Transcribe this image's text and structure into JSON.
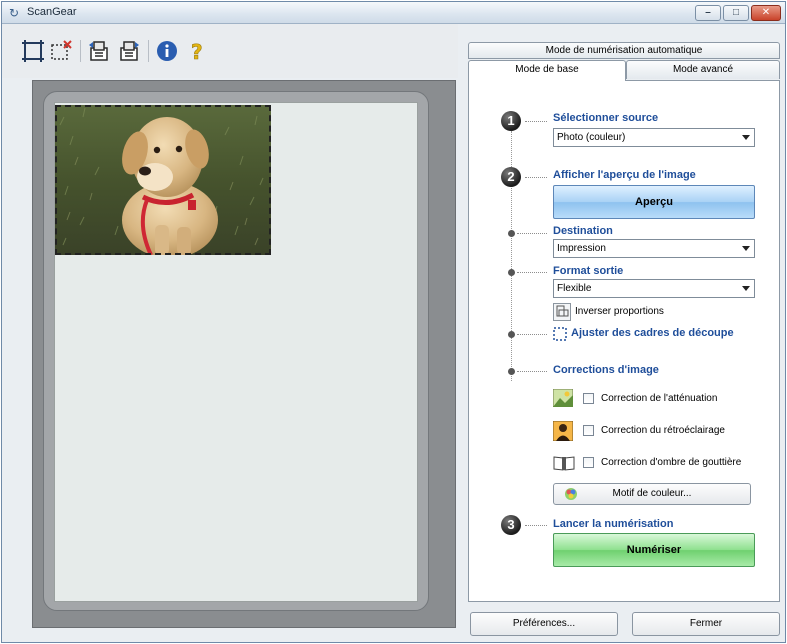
{
  "window": {
    "title": "ScanGear",
    "controls": [
      "minimize-icon",
      "maximize-icon",
      "close-icon"
    ]
  },
  "toolbar": {
    "tools": [
      {
        "name": "auto-crop-icon"
      },
      {
        "name": "remove-crop-icon"
      },
      {
        "name": "rotate-left-icon"
      },
      {
        "name": "rotate-right-icon"
      },
      {
        "name": "info-icon"
      },
      {
        "name": "help-icon"
      }
    ]
  },
  "tabs": {
    "top": "Mode de numérisation automatique",
    "basic": "Mode de base",
    "advanced": "Mode avancé"
  },
  "step1": {
    "number": "1",
    "heading": "Sélectionner source",
    "source_value": "Photo (couleur)"
  },
  "step2": {
    "number": "2",
    "heading": "Afficher l'aperçu de l'image",
    "preview_button": "Aperçu",
    "destination_heading": "Destination",
    "destination_value": "Impression",
    "output_size_heading": "Format sortie",
    "output_size_value": "Flexible",
    "invert_ratio_label": "Inverser proportions",
    "adjust_crop_label": "Ajuster des cadres de découpe",
    "corrections_heading": "Corrections d'image",
    "corrections": [
      {
        "label": "Correction de l'atténuation",
        "checked": false
      },
      {
        "label": "Correction du rétroéclairage",
        "checked": false
      },
      {
        "label": "Correction d'ombre de gouttière",
        "checked": false
      }
    ],
    "color_pattern_button": "Motif de couleur..."
  },
  "step3": {
    "number": "3",
    "heading": "Lancer la numérisation",
    "scan_button": "Numériser"
  },
  "footer": {
    "preferences": "Préférences...",
    "close": "Fermer"
  }
}
